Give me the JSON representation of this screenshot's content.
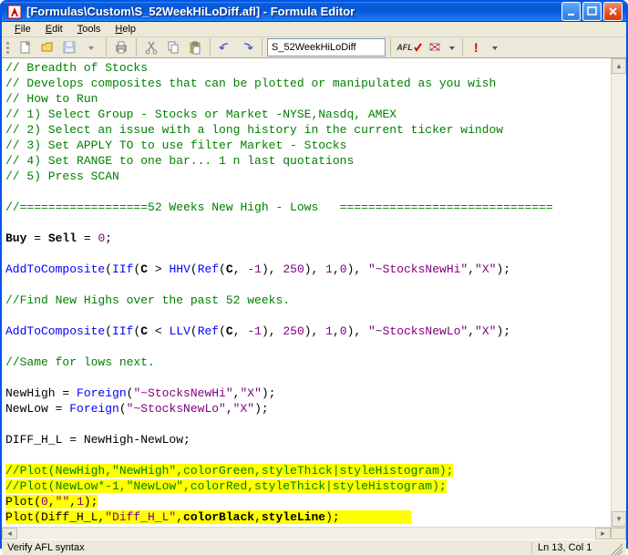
{
  "window": {
    "title": "[Formulas\\Custom\\S_52WeekHiLoDiff.afl] - Formula Editor"
  },
  "menus": {
    "file": "File",
    "edit": "Edit",
    "tools": "Tools",
    "help": "Help"
  },
  "toolbar": {
    "filename_input": "S_52WeekHiLoDiff",
    "afl_label": "AFL"
  },
  "status": {
    "left": "Verify AFL syntax",
    "right": "Ln 13, Col 1"
  },
  "code": {
    "l1": "// Breadth of Stocks",
    "l2": "// Develops composites that can be plotted or manipulated as you wish",
    "l3": "// How to Run",
    "l4": "// 1) Select Group - Stocks or Market -NYSE,Nasdq, AMEX",
    "l5": "// 2) Select an issue with a long history in the current ticker window",
    "l6": "// 3) Set APPLY TO to use filter Market - Stocks",
    "l7": "// 4) Set RANGE to one bar... 1 n last quotations",
    "l8": "// 5) Press SCAN",
    "l10": "//==================52 Weeks New High - Lows   ==============================",
    "l12_buy": "Buy",
    "l12_sell": "Sell",
    "l12_zero": "0",
    "l14_fn": "AddToComposite",
    "l14_iif": "IIf",
    "l14_c": "C",
    "l14_hhv": "HHV",
    "l14_ref": "Ref",
    "l14_neg1": "-1",
    "l14_250": "250",
    "l14_1": "1",
    "l14_0": "0",
    "l14_s1": "\"~StocksNewHi\"",
    "l14_s2": "\"X\"",
    "l16": "//Find New Highs over the past 52 weeks.",
    "l18_fn": "AddToComposite",
    "l18_iif": "IIf",
    "l18_c": "C",
    "l18_llv": "LLV",
    "l18_ref": "Ref",
    "l18_neg1": "-1",
    "l18_250": "250",
    "l18_1": "1",
    "l18_0": "0",
    "l18_s1": "\"~StocksNewLo\"",
    "l18_s2": "\"X\"",
    "l20": "//Same for lows next.",
    "l22_a": "NewHigh = ",
    "l22_fn": "Foreign",
    "l22_s1": "\"~StocksNewHi\"",
    "l22_s2": "\"X\"",
    "l23_a": "NewLow = ",
    "l23_fn": "Foreign",
    "l23_s1": "\"~StocksNewLo\"",
    "l23_s2": "\"X\"",
    "l25": "DIFF_H_L = NewHigh-NewLow;",
    "l27": "//Plot(NewHigh,\"NewHigh\",colorGreen,styleThick|styleHistogram);",
    "l28": "//Plot(NewLow*-1,\"NewLow\",colorRed,styleThick|styleHistogram);",
    "l29_a": "Plot(",
    "l29_0": "0",
    "l29_b": ",",
    "l29_s": "\"\"",
    "l29_c": ",",
    "l29_1": "1",
    "l29_d": ");",
    "l30_a": "Plot(Diff_H_L,",
    "l30_s": "\"Diff_H_L\"",
    "l30_b": ",",
    "l30_k1": "colorBlack",
    "l30_c": ",",
    "l30_k2": "styleLine",
    "l30_d": ");"
  }
}
